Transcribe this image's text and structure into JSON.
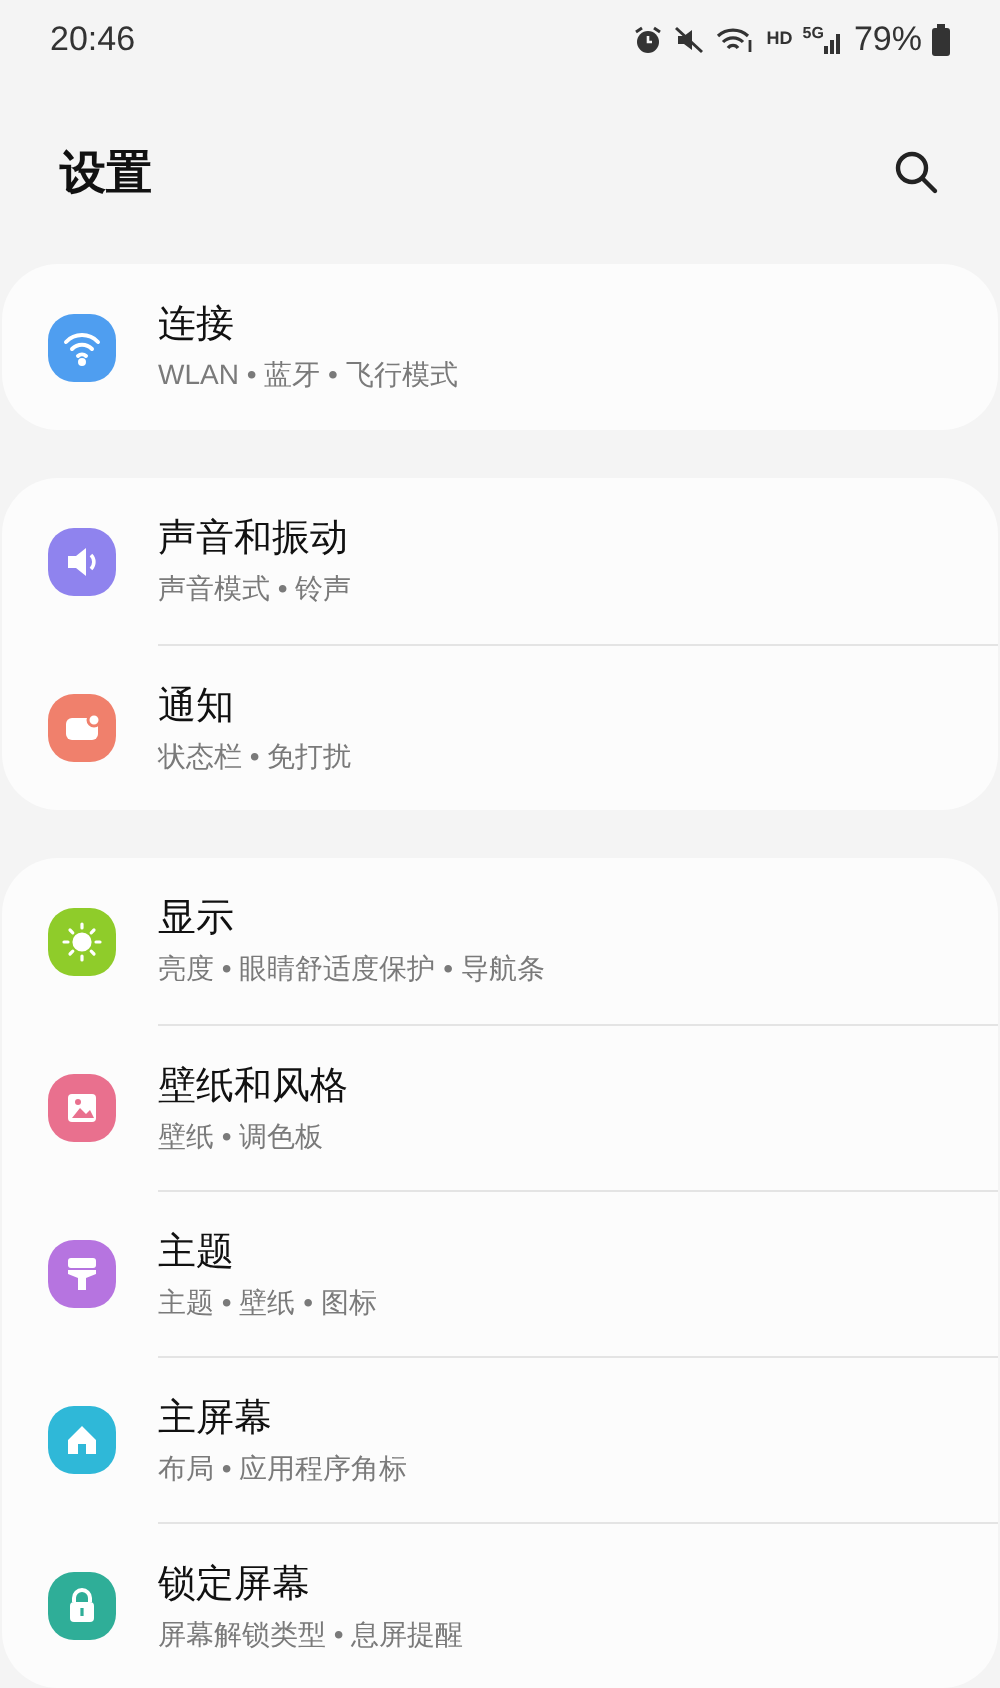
{
  "status_bar": {
    "time": "20:46",
    "hd": "HD",
    "network": "5G",
    "battery": "79%"
  },
  "header": {
    "title": "设置"
  },
  "groups": [
    {
      "items": [
        {
          "kind": "wifi",
          "color": "#4f9ef0",
          "title": "连接",
          "subtitle": "WLAN • 蓝牙 • 飞行模式"
        }
      ]
    },
    {
      "items": [
        {
          "kind": "sound",
          "color": "#8f83ee",
          "title": "声音和振动",
          "subtitle": "声音模式 • 铃声"
        },
        {
          "kind": "notification",
          "color": "#f0806c",
          "title": "通知",
          "subtitle": "状态栏 • 免打扰"
        }
      ]
    },
    {
      "items": [
        {
          "kind": "sun",
          "color": "#8fcc2a",
          "title": "显示",
          "subtitle": "亮度 • 眼睛舒适度保护 • 导航条"
        },
        {
          "kind": "image",
          "color": "#e9708e",
          "title": "壁纸和风格",
          "subtitle": "壁纸 • 调色板"
        },
        {
          "kind": "brush",
          "color": "#b674e0",
          "title": "主题",
          "subtitle": "主题 • 壁纸 • 图标"
        },
        {
          "kind": "home",
          "color": "#2fb8d8",
          "title": "主屏幕",
          "subtitle": "布局 • 应用程序角标"
        },
        {
          "kind": "lock",
          "color": "#2fae98",
          "title": "锁定屏幕",
          "subtitle": "屏幕解锁类型 • 息屏提醒"
        }
      ]
    }
  ]
}
